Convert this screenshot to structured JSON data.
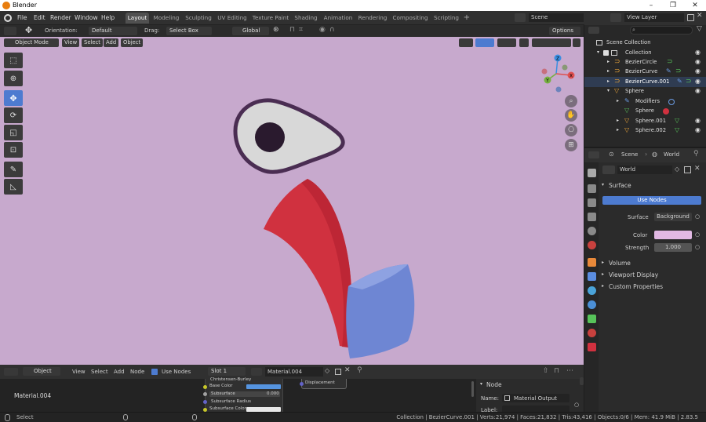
{
  "window": {
    "title": "Blender",
    "minimize": "–",
    "maximize": "❐",
    "close": "✕"
  },
  "menu": [
    "File",
    "Edit",
    "Render",
    "Window",
    "Help"
  ],
  "workspaces": [
    "Layout",
    "Modeling",
    "Sculpting",
    "UV Editing",
    "Texture Paint",
    "Shading",
    "Animation",
    "Rendering",
    "Compositing",
    "Scripting"
  ],
  "add_workspace": "+",
  "scene": {
    "name": "Scene",
    "view_layer": "View Layer"
  },
  "tool_header": {
    "orientation_label": "Orientation:",
    "orientation_value": "Default",
    "drag_label": "Drag:",
    "drag_value": "Select Box",
    "transform_value": "Global",
    "options": "Options"
  },
  "viewport_header": {
    "mode": "Object Mode",
    "view": "View",
    "select": "Select",
    "add": "Add",
    "object": "Object"
  },
  "gizmo": {
    "x": "X",
    "y": "Y",
    "z": "Z"
  },
  "outliner": {
    "search_placeholder": "",
    "rows": [
      {
        "label": "Scene Collection",
        "icon": "scene-collection-icon"
      },
      {
        "label": "Collection",
        "icon": "collection-icon"
      },
      {
        "label": "BezierCircle",
        "icon": "curve-icon"
      },
      {
        "label": "BezierCurve",
        "icon": "curve-icon"
      },
      {
        "label": "BezierCurve.001",
        "icon": "curve-icon"
      },
      {
        "label": "Sphere",
        "icon": "mesh-icon"
      },
      {
        "label": "Modifiers",
        "icon": "wrench-icon"
      },
      {
        "label": "Sphere",
        "icon": "mesh-data-icon"
      },
      {
        "label": "Sphere.001",
        "icon": "mesh-icon"
      },
      {
        "label": "Sphere.002",
        "icon": "mesh-icon"
      }
    ]
  },
  "properties": {
    "scene_tab": "Scene",
    "world_tab": "World",
    "world_name": "World",
    "surface_panel": "Surface",
    "use_nodes": "Use Nodes",
    "surface_label": "Surface",
    "surface_value": "Background",
    "color_label": "Color",
    "color_value": "#e2b9e4",
    "strength_label": "Strength",
    "strength_value": "1.000",
    "volume_panel": "Volume",
    "viewport_display_panel": "Viewport Display",
    "custom_properties_panel": "Custom Properties"
  },
  "node_header": {
    "object": "Object",
    "view": "View",
    "select": "Select",
    "add": "Add",
    "node": "Node",
    "use_nodes": "Use Nodes",
    "slot": "Slot 1",
    "material": "Material.004"
  },
  "node_editor": {
    "material_label": "Material.004",
    "bsdf_rows": [
      "Christensen-Burley",
      "Base Color",
      "Subsurface",
      "Subsurface Radius",
      "Subsurface Color"
    ],
    "subsurface_value": "0.000",
    "output_row": "Displacement"
  },
  "node_panel": {
    "title": "Node",
    "name_label": "Name:",
    "name_value": "Material Output",
    "label_label": "Label:"
  },
  "status": {
    "select": "Select",
    "info": "Collection | BezierCurve.001 | Verts:21,974 | Faces:21,832 | Tris:43,416 | Objects:0/6 | Mem: 41.9 MiB | 2.83.5"
  },
  "colors": {
    "viewport_bg": "#c7a9cd",
    "accent_blue": "#4d7bd0",
    "red_object": "#d0313f",
    "blue_object": "#6e86d3"
  }
}
